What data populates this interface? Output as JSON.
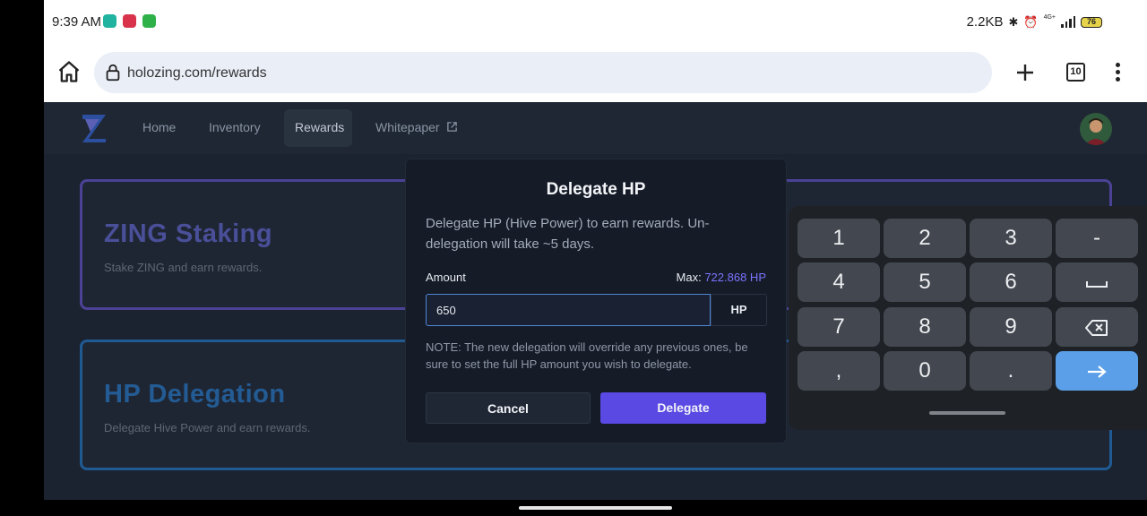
{
  "status_bar": {
    "time": "9:39 AM",
    "data_speed": "2.2KB",
    "network": "4G+",
    "battery": "76",
    "notification_icons": [
      "whatsapp-icon",
      "mail-icon",
      "shield-icon"
    ]
  },
  "browser": {
    "url": "holozing.com/rewards",
    "tab_count": "10"
  },
  "nav": {
    "items": [
      "Home",
      "Inventory",
      "Rewards",
      "Whitepaper"
    ],
    "active": "Rewards"
  },
  "cards": [
    {
      "title": "ZING Staking",
      "subtitle": "Stake ZING and earn rewards."
    },
    {
      "title": "HP Delegation",
      "subtitle": "Delegate Hive Power and earn rewards."
    }
  ],
  "modal": {
    "title": "Delegate HP",
    "description": "Delegate HP (Hive Power) to earn rewards. Un-delegation will take ~5 days.",
    "amount_label": "Amount",
    "max_label": "Max:",
    "max_value": "722.868 HP",
    "amount_value": "650",
    "unit": "HP",
    "note": "NOTE: The new delegation will override any previous ones, be sure to set the full HP amount you wish to delegate.",
    "cancel_label": "Cancel",
    "delegate_label": "Delegate"
  },
  "keyboard": {
    "keys": [
      "1",
      "2",
      "3",
      "-",
      "4",
      "5",
      "6",
      "space",
      "7",
      "8",
      "9",
      "backspace",
      ",",
      "0",
      ".",
      "enter"
    ]
  },
  "colors": {
    "accent": "#5a49e3",
    "max_value": "#7b73ff",
    "enter_key": "#5a9fe8",
    "page_bg": "#1b2330"
  }
}
